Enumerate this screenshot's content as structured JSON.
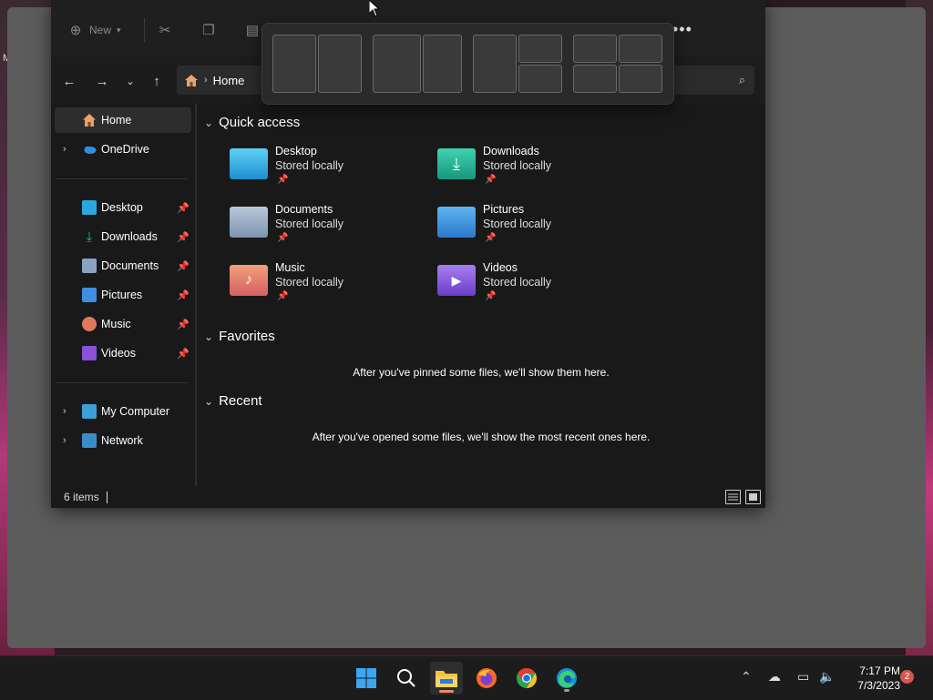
{
  "desktop": {
    "label": "M"
  },
  "toolbar": {
    "new_label": "New",
    "more_label": "•••"
  },
  "address": {
    "current": "Home"
  },
  "navpane": {
    "home": "Home",
    "onedrive": "OneDrive",
    "pinned": [
      "Desktop",
      "Downloads",
      "Documents",
      "Pictures",
      "Music",
      "Videos"
    ],
    "my_computer": "My Computer",
    "network": "Network"
  },
  "sections": {
    "quick_access": "Quick access",
    "favorites": "Favorites",
    "recent": "Recent"
  },
  "quick_access_items": [
    {
      "name": "Desktop",
      "sub": "Stored locally",
      "color": "#2aa7e0"
    },
    {
      "name": "Downloads",
      "sub": "Stored locally",
      "color": "#1fb59a"
    },
    {
      "name": "Documents",
      "sub": "Stored locally",
      "color": "#8aa3c2"
    },
    {
      "name": "Pictures",
      "sub": "Stored locally",
      "color": "#3d8fe0"
    },
    {
      "name": "Music",
      "sub": "Stored locally",
      "color": "#e0785a"
    },
    {
      "name": "Videos",
      "sub": "Stored locally",
      "color": "#8a52d6"
    }
  ],
  "messages": {
    "favorites_empty": "After you've pinned some files, we'll show them here.",
    "recent_empty": "After you've opened some files, we'll show the most recent ones here."
  },
  "status": {
    "items": "6 items"
  },
  "taskbar": {
    "time": "7:17 PM",
    "date": "7/3/2023",
    "notifications": "2"
  },
  "icons": {
    "new": "plus-circle-icon",
    "cut": "scissors-icon",
    "copy": "copy-icon",
    "paste": "clipboard-icon",
    "back": "arrow-left-icon",
    "forward": "arrow-right-icon",
    "recent_locations": "chevron-down-icon",
    "up": "arrow-up-icon",
    "home": "home-icon",
    "search": "search-icon"
  }
}
